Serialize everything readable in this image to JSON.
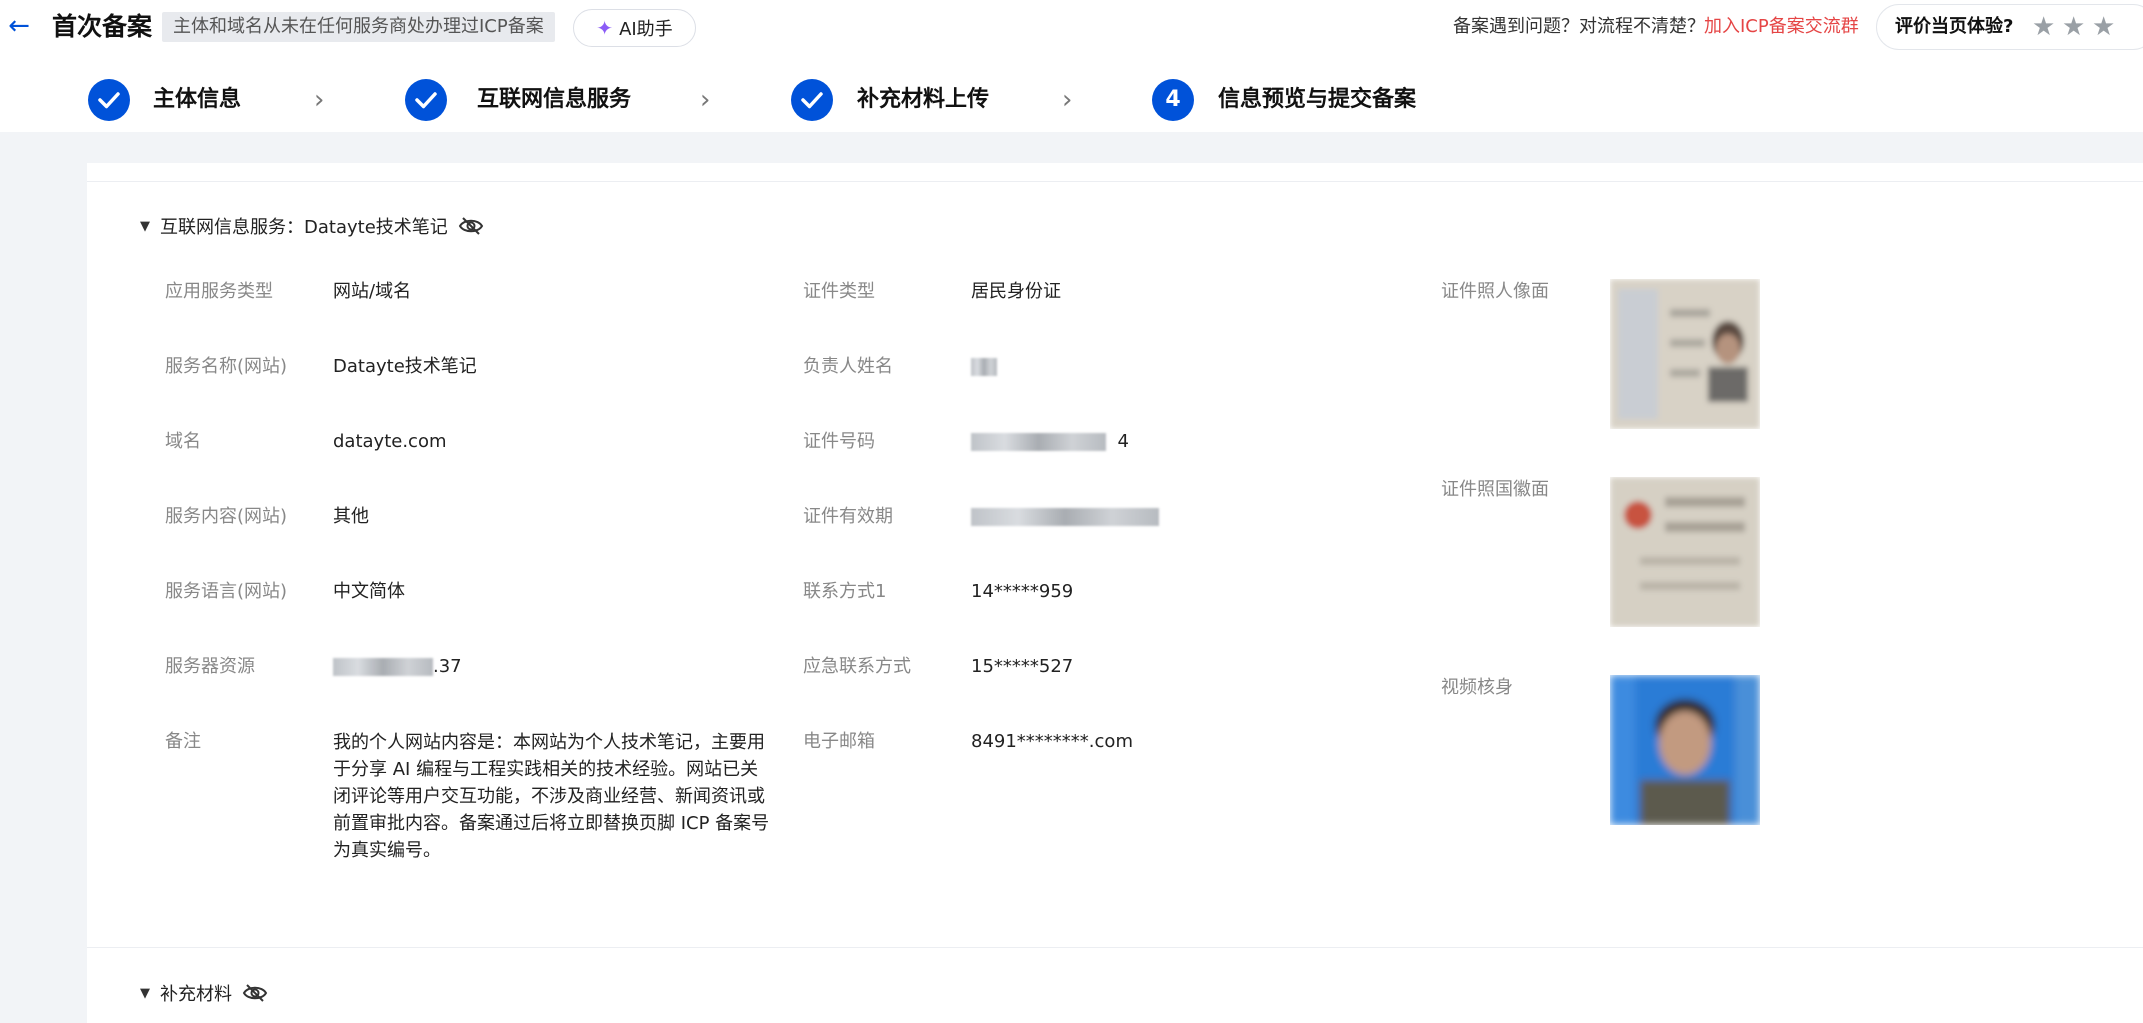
{
  "header": {
    "title": "首次备案",
    "tag": "主体和域名从未在任何服务商处办理过ICP备案",
    "ai_button": "AI助手",
    "help_text": "备案遇到问题？对流程不清楚？",
    "help_link": "加入ICP备案交流群",
    "rate_label": "评价当页体验?",
    "stars": [
      "★",
      "★",
      "★"
    ]
  },
  "steps": [
    {
      "label": "主体信息",
      "status": "done"
    },
    {
      "label": "互联网信息服务",
      "status": "done"
    },
    {
      "label": "补充材料上传",
      "status": "done"
    },
    {
      "label": "信息预览与提交备案",
      "status": "current",
      "number": "4"
    }
  ],
  "service_section": {
    "title": "互联网信息服务：Datayte技术笔记",
    "col1": [
      {
        "label": "应用服务类型",
        "value": "网站/域名"
      },
      {
        "label": "服务名称(网站)",
        "value": "Datayte技术笔记"
      },
      {
        "label": "域名",
        "value": "datayte.com"
      },
      {
        "label": "服务内容(网站)",
        "value": "其他"
      },
      {
        "label": "服务语言(网站)",
        "value": "中文简体"
      },
      {
        "label": "服务器资源",
        "value_suffix": ".37"
      },
      {
        "label": "备注",
        "value": "我的个人网站内容是：本网站为个人技术笔记，主要用于分享 AI 编程与工程实践相关的技术经验。网站已关闭评论等用户交互功能，不涉及商业经营、新闻资讯或前置审批内容。备案通过后将立即替换页脚 ICP 备案号为真实编号。"
      }
    ],
    "col2": [
      {
        "label": "证件类型",
        "value": "居民身份证"
      },
      {
        "label": "负责人姓名"
      },
      {
        "label": "证件号码",
        "value_suffix": "4"
      },
      {
        "label": "证件有效期"
      },
      {
        "label": "联系方式1",
        "value": "14*****959"
      },
      {
        "label": "应急联系方式",
        "value": "15*****527"
      },
      {
        "label": "电子邮箱",
        "value": "8491********.com"
      }
    ],
    "col3": [
      {
        "label": "证件照人像面"
      },
      {
        "label": "证件照国徽面"
      },
      {
        "label": "视频核身"
      }
    ]
  },
  "supplement_section": {
    "title": "补充材料"
  },
  "colors": {
    "primary": "#0052d9",
    "link_red": "#e54545"
  }
}
